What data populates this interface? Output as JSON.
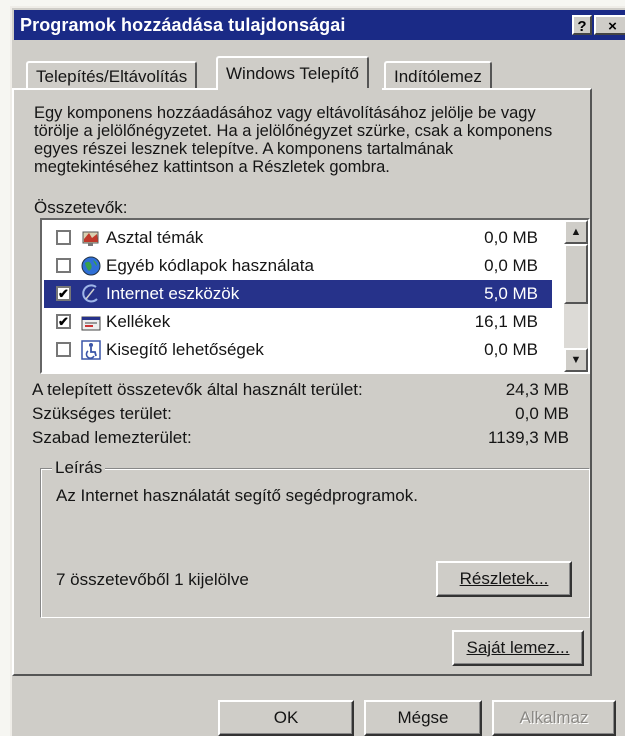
{
  "window": {
    "title": "Programok hozzáadása tulajdonságai",
    "help_label": "?",
    "close_label": "×"
  },
  "tabs": [
    {
      "label": "Telepítés/Eltávolítás",
      "active": false
    },
    {
      "label": "Windows Telepítő",
      "active": true
    },
    {
      "label": "Indítólemez",
      "active": false
    }
  ],
  "description": "Egy komponens hozzáadásához vagy eltávolításához jelölje be vagy törölje a jelölőnégyzetet. Ha a jelölőnégyzet szürke, csak a komponens egyes részei lesznek telepítve. A komponens tartalmának megtekintéséhez kattintson a Részletek gombra.",
  "components_label": "Összetevők:",
  "components": [
    {
      "name": "Asztal témák",
      "size": "0,0 MB",
      "checked": false,
      "selected": false,
      "icon": "desktop-themes-icon"
    },
    {
      "name": "Egyéb kódlapok használata",
      "size": "0,0 MB",
      "checked": false,
      "selected": false,
      "icon": "globe-icon"
    },
    {
      "name": "Internet eszközök",
      "size": "5,0 MB",
      "checked": true,
      "selected": true,
      "icon": "internet-tools-icon"
    },
    {
      "name": "Kellékek",
      "size": "16,1 MB",
      "checked": true,
      "selected": false,
      "icon": "accessories-icon"
    },
    {
      "name": "Kisegítő lehetőségek",
      "size": "0,0 MB",
      "checked": false,
      "selected": false,
      "icon": "accessibility-icon"
    }
  ],
  "space": {
    "used_label": "A telepített összetevők által használt terület:",
    "used_value": "24,3 MB",
    "required_label": "Szükséges terület:",
    "required_value": "0,0 MB",
    "free_label": "Szabad lemezterület:",
    "free_value": "1139,3 MB"
  },
  "info": {
    "legend": "Leírás",
    "text": "Az Internet használatát segítő segédprogramok.",
    "selection_count": "7 összetevőből 1 kijelölve",
    "details_button": "Részletek..."
  },
  "have_disk_button": "Saját lemez...",
  "footer": {
    "ok": "OK",
    "cancel": "Mégse",
    "apply": "Alkalmaz"
  },
  "colors": {
    "title_bar": "#1a2a86",
    "selection": "#26328a",
    "face": "#cfcdc8"
  }
}
